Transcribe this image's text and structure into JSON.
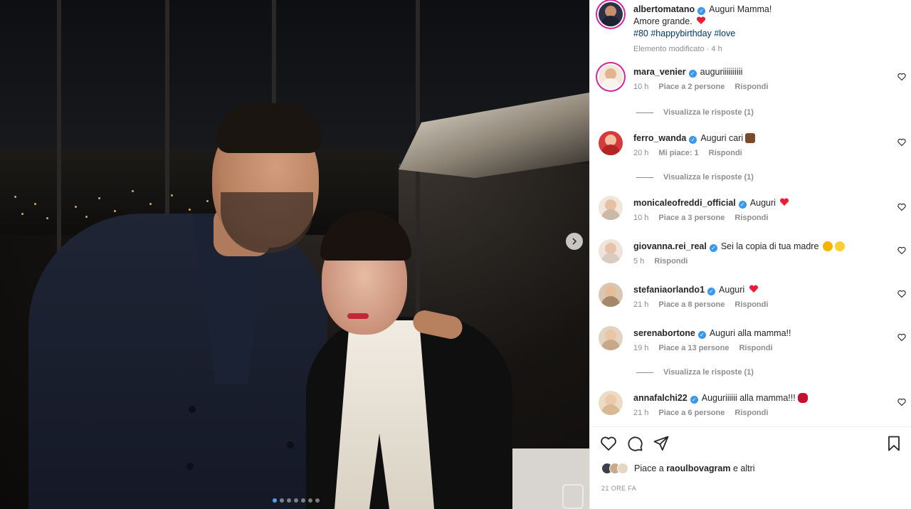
{
  "post": {
    "author": "albertomatano",
    "caption_line1": "Auguri Mamma!",
    "caption_line2": "Amore grande.",
    "hashtags": [
      "#80",
      "#happybirthday",
      "#love"
    ],
    "edited_label": "Elemento modificato · 4 h"
  },
  "comments": [
    {
      "user": "mara_venier",
      "text": "auguriiiiiiiiii",
      "time": "10 h",
      "likes": "Piace a 2 persone",
      "reply": "Rispondi",
      "view_replies": "Visualizza le risposte (1)",
      "emoji": ""
    },
    {
      "user": "ferro_wanda",
      "text": "Auguri cari",
      "time": "20 h",
      "likes": "Mi piace: 1",
      "reply": "Rispondi",
      "view_replies": "Visualizza le risposte (1)",
      "emoji": "cake"
    },
    {
      "user": "monicaleofreddi_official",
      "text": "Auguri",
      "time": "10 h",
      "likes": "Piace a 3 persone",
      "reply": "Rispondi",
      "view_replies": "",
      "emoji": "heart"
    },
    {
      "user": "giovanna.rei_real",
      "text": "Sei la copia di tua madre",
      "time": "5 h",
      "likes": "",
      "reply": "Rispondi",
      "view_replies": "",
      "emoji": "star-eyes kiss"
    },
    {
      "user": "stefaniaorlando1",
      "text": "Auguri",
      "time": "21 h",
      "likes": "Piace a 8 persone",
      "reply": "Rispondi",
      "view_replies": "",
      "emoji": "heart"
    },
    {
      "user": "serenabortone",
      "text": "Auguri alla mamma!!",
      "time": "19 h",
      "likes": "Piace a 13 persone",
      "reply": "Rispondi",
      "view_replies": "Visualizza le risposte (1)",
      "emoji": ""
    },
    {
      "user": "annafalchi22",
      "text": "Auguriiiiii alla mamma!!!",
      "time": "21 h",
      "likes": "Piace a 6 persone",
      "reply": "Rispondi",
      "view_replies": "",
      "emoji": "lips"
    }
  ],
  "likes": {
    "prefix": "Piace a",
    "user": "raoulbovagram",
    "suffix": "e altri"
  },
  "posted_ago": "21 ORE FA",
  "carousel": {
    "count": 7,
    "active": 0
  },
  "icons": {
    "like": "heart-icon",
    "comment": "comment-icon",
    "share": "share-icon",
    "save": "bookmark-icon",
    "next": "chevron-right-icon",
    "verified": "verified-badge-icon"
  },
  "colors": {
    "verified": "#3897f0",
    "hashtag": "#00376b",
    "meta": "#8e8e8e",
    "heart_emoji": "#ed1c33"
  }
}
